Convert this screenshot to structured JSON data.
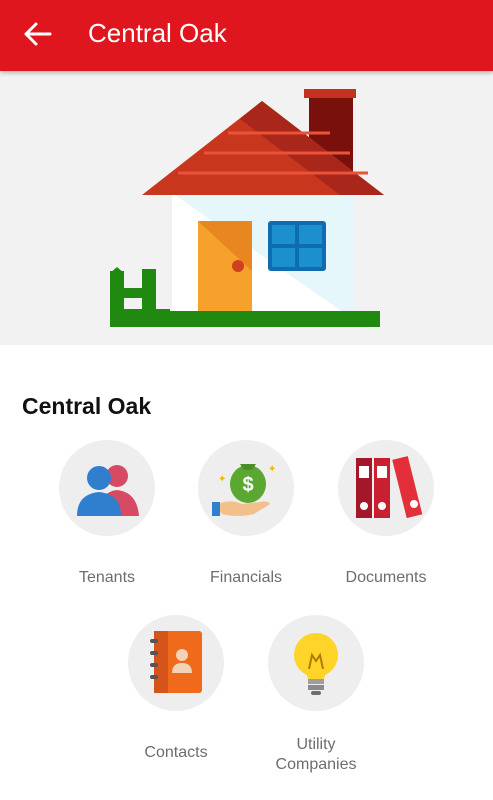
{
  "appbar": {
    "title": "Central Oak",
    "back_icon": "arrow-back-icon",
    "color": "#e0161e"
  },
  "hero": {
    "illustration": "house-illustration"
  },
  "section": {
    "title": "Central Oak"
  },
  "tiles": [
    {
      "label": "Tenants",
      "icon": "tenants-icon"
    },
    {
      "label": "Financials",
      "icon": "money-bag-hand-icon"
    },
    {
      "label": "Documents",
      "icon": "binders-icon"
    },
    {
      "label": "Contacts",
      "icon": "address-book-icon"
    },
    {
      "label": "Utility Companies",
      "icon": "lightbulb-icon"
    }
  ]
}
